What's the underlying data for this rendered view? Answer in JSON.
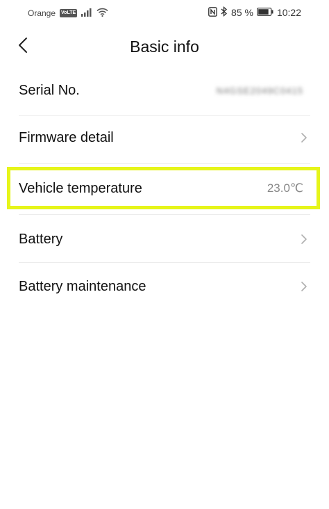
{
  "status_bar": {
    "carrier": "Orange",
    "volte_badge": "VoLTE",
    "battery_percent": "85 %",
    "time": "10:22",
    "icons": [
      "signal-icon",
      "wifi-icon",
      "nfc-icon",
      "bluetooth-icon",
      "battery-icon"
    ]
  },
  "header": {
    "title": "Basic info",
    "back_icon": "chevron-left-icon"
  },
  "rows": [
    {
      "label": "Serial No.",
      "value": "N4GSE2049C0415",
      "has_chevron": false
    },
    {
      "label": "Firmware detail",
      "value": "",
      "has_chevron": true
    },
    {
      "label": "Vehicle temperature",
      "value": "23.0℃",
      "has_chevron": false,
      "highlighted": true
    },
    {
      "label": "Battery",
      "value": "",
      "has_chevron": true
    },
    {
      "label": "Battery maintenance",
      "value": "",
      "has_chevron": true
    }
  ],
  "colors": {
    "highlight": "#e6f51a",
    "value_text": "#888888",
    "chevron": "#b0b0b0"
  }
}
